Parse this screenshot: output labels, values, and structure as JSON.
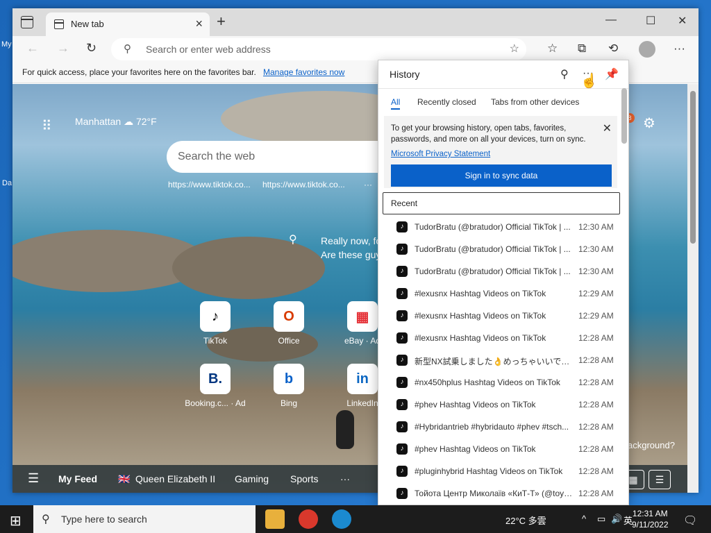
{
  "desktop": {
    "label_top": "My",
    "label_mid": "Da"
  },
  "browser": {
    "tab_title": "New tab",
    "address_placeholder": "Search or enter web address",
    "favbar_text": "For quick access, place your favorites here on the favorites bar.",
    "favbar_link": "Manage favorites now"
  },
  "newtab": {
    "location": "Manhattan",
    "temperature": "72°F",
    "search_placeholder": "Search the web",
    "quick_links": [
      "https://www.tiktok.co...",
      "https://www.tiktok.co..."
    ],
    "hero_line1": "Really now, fo",
    "hero_line2": "Are these guy",
    "tiles": [
      {
        "label": "TikTok",
        "glyph": "♪",
        "color": "#000000"
      },
      {
        "label": "Office",
        "glyph": "O",
        "color": "#d83b01"
      },
      {
        "label": "eBay · Ad",
        "glyph": "▦",
        "color": "#e53238"
      },
      {
        "label": "Booking.c... · Ad",
        "glyph": "B.",
        "color": "#003580"
      },
      {
        "label": "Bing",
        "glyph": "b",
        "color": "#0a61c9"
      },
      {
        "label": "LinkedIn",
        "glyph": "in",
        "color": "#0a66c2"
      }
    ],
    "badge": "8",
    "background_question": "ackground?",
    "feed_items": [
      "My Feed",
      "Queen Elizabeth II",
      "Gaming",
      "Sports",
      "···"
    ]
  },
  "history": {
    "title": "History",
    "tabs": [
      "All",
      "Recently closed",
      "Tabs from other devices"
    ],
    "sync_text": "To get your browsing history, open tabs, favorites, passwords, and more on all your devices, turn on sync.",
    "privacy_link": "Microsoft Privacy Statement",
    "sync_button": "Sign in to sync data",
    "recent_label": "Recent",
    "items": [
      {
        "title": "TudorBratu (@bratudor) Official TikTok | ...",
        "time": "12:30 AM"
      },
      {
        "title": "TudorBratu (@bratudor) Official TikTok | ...",
        "time": "12:30 AM"
      },
      {
        "title": "TudorBratu (@bratudor) Official TikTok | ...",
        "time": "12:30 AM"
      },
      {
        "title": "#lexusnx Hashtag Videos on TikTok",
        "time": "12:29 AM"
      },
      {
        "title": "#lexusnx Hashtag Videos on TikTok",
        "time": "12:29 AM"
      },
      {
        "title": "#lexusnx Hashtag Videos on TikTok",
        "time": "12:28 AM"
      },
      {
        "title": "新型NX試乗しました👌めっちゃいいです...",
        "time": "12:28 AM"
      },
      {
        "title": "#nx450hplus Hashtag Videos on TikTok",
        "time": "12:28 AM"
      },
      {
        "title": "#phev Hashtag Videos on TikTok",
        "time": "12:28 AM"
      },
      {
        "title": "#Hybridantrieb #hybridauto #phev #tsch...",
        "time": "12:28 AM"
      },
      {
        "title": "#phev Hashtag Videos on TikTok",
        "time": "12:28 AM"
      },
      {
        "title": "#pluginhybrid Hashtag Videos on TikTok",
        "time": "12:28 AM"
      },
      {
        "title": "Тойота Центр Миколаїв «КиТ-Т» (@toyo...",
        "time": "12:28 AM"
      }
    ]
  },
  "taskbar": {
    "search_placeholder": "Type here to search",
    "weather": "22°C 多雲",
    "lang": "英",
    "time": "12:31 AM",
    "date": "9/11/2022"
  }
}
